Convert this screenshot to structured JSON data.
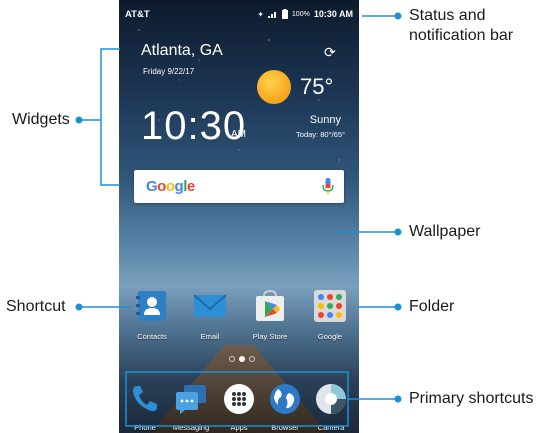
{
  "phone": {
    "status_bar": {
      "carrier": "AT&T",
      "battery": "100%",
      "time": "10:30 AM"
    },
    "weather_widget": {
      "city": "Atlanta, GA",
      "date": "Friday 9/22/17",
      "temperature": "75°",
      "clock": "10:30",
      "ampm": "AM",
      "condition": "Sunny",
      "today_range": "Today: 80°/65°"
    },
    "search_widget": {
      "logo": "Google"
    },
    "shortcuts": [
      {
        "label": "Contacts",
        "icon": "contacts-icon"
      },
      {
        "label": "Email",
        "icon": "email-icon"
      },
      {
        "label": "Play Store",
        "icon": "play-store-icon"
      },
      {
        "label": "Google",
        "icon": "google-folder-icon"
      }
    ],
    "page_indicator": {
      "pages": 3,
      "active": 2
    },
    "dock": [
      {
        "label": "Phone",
        "icon": "phone-icon"
      },
      {
        "label": "Messaging",
        "icon": "messaging-icon"
      },
      {
        "label": "Apps",
        "icon": "apps-icon"
      },
      {
        "label": "Browser",
        "icon": "browser-icon"
      },
      {
        "label": "Camera",
        "icon": "camera-icon"
      }
    ]
  },
  "callouts": {
    "status_bar": "Status and notification bar",
    "widgets": "Widgets",
    "wallpaper": "Wallpaper",
    "shortcut": "Shortcut",
    "folder": "Folder",
    "primary_shortcuts": "Primary shortcuts"
  },
  "colors": {
    "callout_blue": "#1f8fd6",
    "sun": "#f7a21b"
  }
}
